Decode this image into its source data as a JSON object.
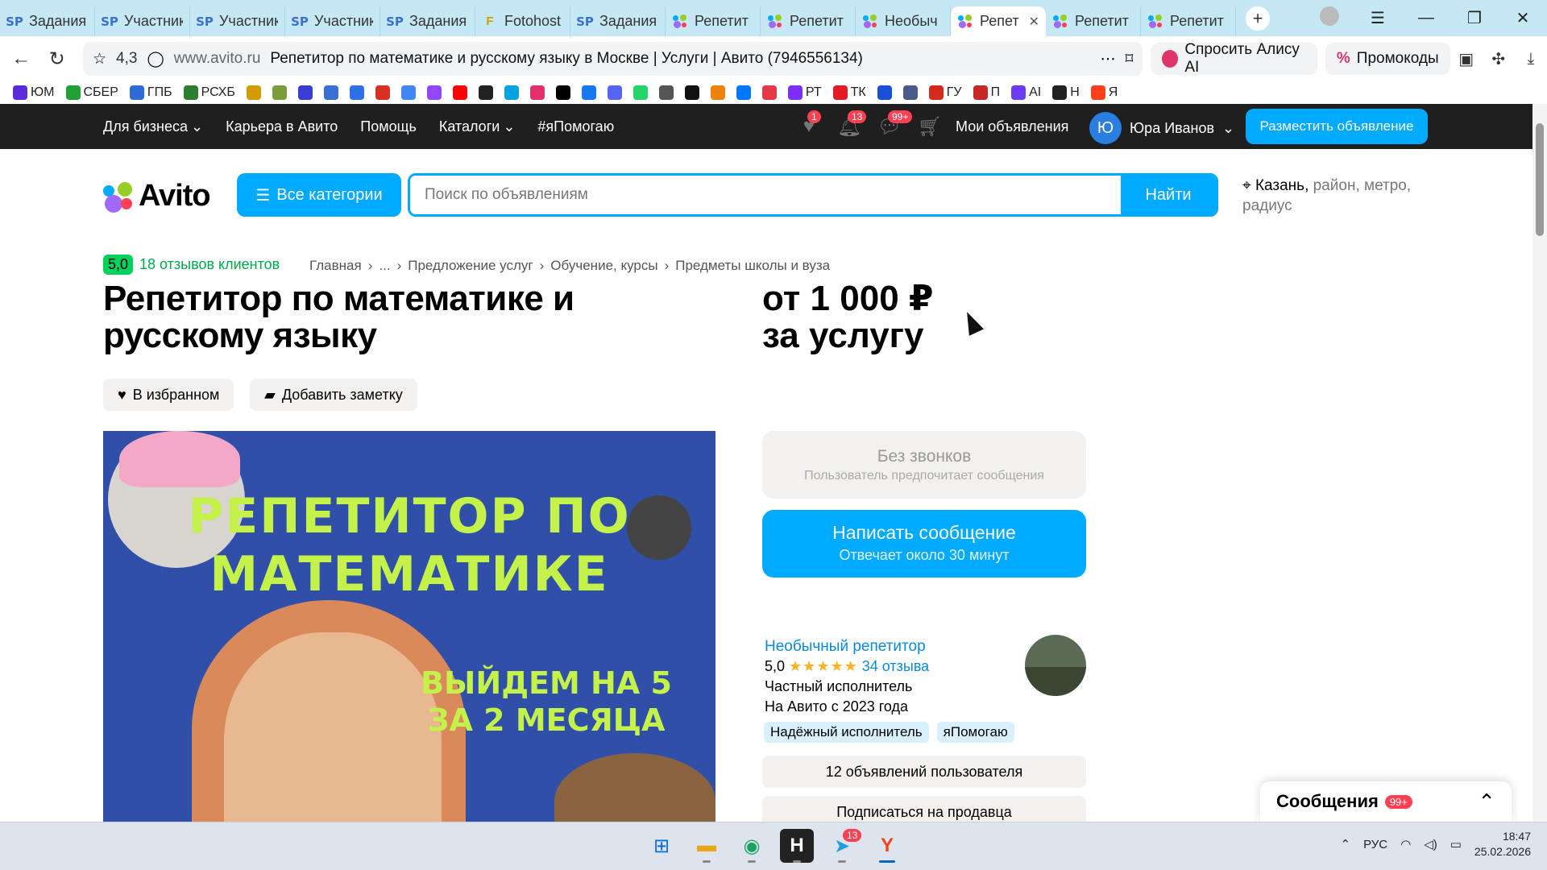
{
  "browser": {
    "tabs": [
      {
        "label": "Задания",
        "icon": "sp"
      },
      {
        "label": "Участник",
        "icon": "sp"
      },
      {
        "label": "Участник",
        "icon": "sp"
      },
      {
        "label": "Участник",
        "icon": "sp"
      },
      {
        "label": "Задания",
        "icon": "sp"
      },
      {
        "label": "Fotohost",
        "icon": "f"
      },
      {
        "label": "Задания",
        "icon": "sp"
      },
      {
        "label": "Репетит",
        "icon": "avito"
      },
      {
        "label": "Репетит",
        "icon": "avito"
      },
      {
        "label": "Необыч",
        "icon": "avito"
      },
      {
        "label": "Репет",
        "icon": "avito",
        "active": true
      },
      {
        "label": "Репетит",
        "icon": "avito"
      },
      {
        "label": "Репетит",
        "icon": "avito"
      }
    ],
    "address": {
      "rating": "4,3",
      "domain": "www.avito.ru",
      "title": "Репетитор по математике и русскому языку в Москве | Услуги | Авито (7946556134)"
    },
    "alice_label": "Спросить Алису AI",
    "promo_label": "Промокоды",
    "bookmarks": [
      {
        "label": "ЮМ",
        "color": "#5b2bd9"
      },
      {
        "label": "СБЕР",
        "color": "#21a038"
      },
      {
        "label": "ГПБ",
        "color": "#2e6bd6"
      },
      {
        "label": "РСХБ",
        "color": "#2f7d32"
      },
      {
        "label": "",
        "color": "#d49a00"
      },
      {
        "label": "",
        "color": "#7a9c3a"
      },
      {
        "label": "",
        "color": "#3b3bd6"
      },
      {
        "label": "",
        "color": "#3b6fd4"
      },
      {
        "label": "",
        "color": "#2f6fe8"
      },
      {
        "label": "",
        "color": "#d93025"
      },
      {
        "label": "",
        "color": "#4285f4"
      },
      {
        "label": "",
        "color": "#9146ff"
      },
      {
        "label": "",
        "color": "#ff0000"
      },
      {
        "label": "",
        "color": "#222222"
      },
      {
        "label": "",
        "color": "#00a3e0"
      },
      {
        "label": "",
        "color": "#e1306c"
      },
      {
        "label": "",
        "color": "#000000"
      },
      {
        "label": "",
        "color": "#1877f2"
      },
      {
        "label": "",
        "color": "#5865f2"
      },
      {
        "label": "",
        "color": "#25d366"
      },
      {
        "label": "",
        "color": "#555555"
      },
      {
        "label": "",
        "color": "#111111"
      },
      {
        "label": "",
        "color": "#ee8208"
      },
      {
        "label": "",
        "color": "#0077ff"
      },
      {
        "label": "",
        "color": "#e63946"
      },
      {
        "label": "РТ",
        "color": "#7b2ff7"
      },
      {
        "label": "ТК",
        "color": "#e31b23"
      },
      {
        "label": "",
        "color": "#1a4fd6"
      },
      {
        "label": "",
        "color": "#4a5a8a"
      },
      {
        "label": "ГУ",
        "color": "#d52b1e"
      },
      {
        "label": "П",
        "color": "#c62828"
      },
      {
        "label": "AI",
        "color": "#6a3df5"
      },
      {
        "label": "Н",
        "color": "#222222"
      },
      {
        "label": "Я",
        "color": "#fc3f1d"
      }
    ]
  },
  "avito_header": {
    "links": [
      "Для бизнеса",
      "Карьера в Авито",
      "Помощь",
      "Каталоги",
      "#яПомогаю"
    ],
    "dropdown_links": [
      true,
      false,
      false,
      true,
      false
    ],
    "fav_badge": "1",
    "notif_badge": "13",
    "msg_badge": "99+",
    "my_ads": "Мои объявления",
    "user_initial": "Ю",
    "user_name": "Юра Иванов",
    "post_button": "Разместить объявление"
  },
  "search": {
    "logo": "Avito",
    "categories_button": "Все категории",
    "placeholder": "Поиск по объявлениям",
    "find_button": "Найти",
    "location_city": "Казань,",
    "location_more": "район, метро, радиус"
  },
  "listing": {
    "rating_score": "5,0",
    "reviews_label": "18 отзывов клиентов",
    "breadcrumbs": [
      "Главная",
      "›",
      "...",
      "›",
      "Предложение услуг",
      "›",
      "Обучение, курсы",
      "›",
      "Предметы школы и вуза"
    ],
    "title": "Репетитор по математике и русскому языку",
    "price_line1": "от 1 000 ₽",
    "price_line2": "за услугу",
    "favorite_button": "В избранном",
    "note_button": "Добавить заметку",
    "photo_text_1": "РЕПЕТИТОР ПО",
    "photo_text_2": "МАТЕМАТИКЕ",
    "photo_text_3": "ВЫЙДЕМ НА 5",
    "photo_text_4": "ЗА 2 МЕСЯЦА"
  },
  "contact": {
    "no_calls_title": "Без звонков",
    "no_calls_sub": "Пользователь предпочитает сообщения",
    "message_title": "Написать сообщение",
    "message_sub": "Отвечает около 30 минут"
  },
  "seller": {
    "name": "Необычный репетитор",
    "rating": "5,0",
    "stars": "★★★★★",
    "reviews": "34 отзыва",
    "type": "Частный исполнитель",
    "since": "На Авито с 2023 года",
    "tags": [
      "Надёжный исполнитель",
      "яПомогаю"
    ],
    "ads_button": "12 объявлений пользователя",
    "subscribe_button": "Подписаться на продавца"
  },
  "messages_panel": {
    "title": "Сообщения",
    "badge": "99+"
  },
  "taskbar": {
    "telegram_badge": "13",
    "lang": "РУС",
    "time": "18:47",
    "date": "25.02.2026"
  }
}
